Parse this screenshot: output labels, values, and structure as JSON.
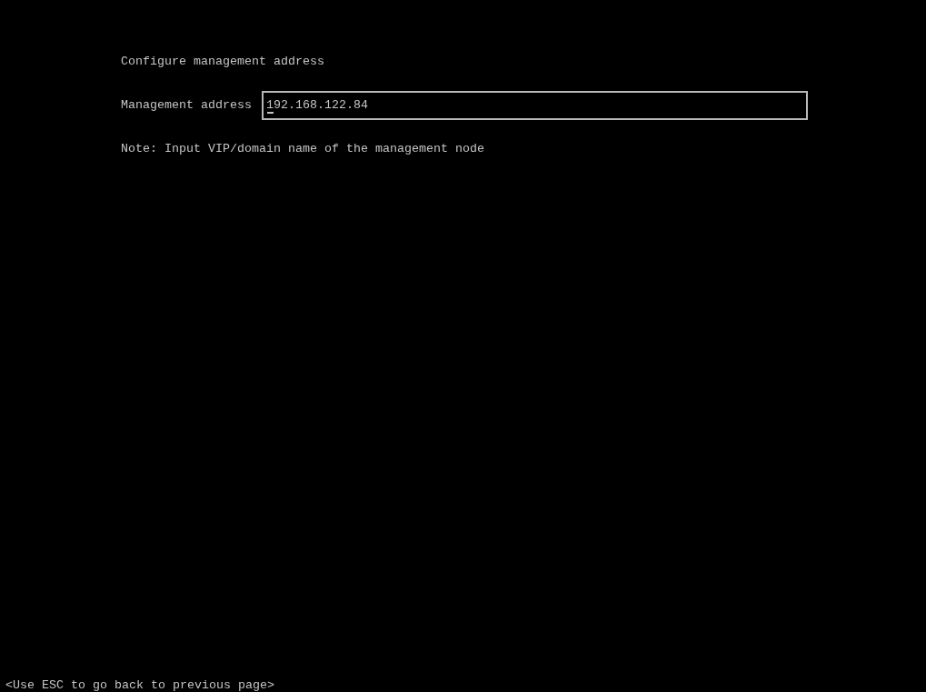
{
  "screen": {
    "title": "Configure management address"
  },
  "field": {
    "label": "Management address",
    "value": "192.168.122.84",
    "focused": true
  },
  "note": "Note: Input VIP/domain name of the management node",
  "footer_hint": "<Use ESC to go back to previous page>"
}
